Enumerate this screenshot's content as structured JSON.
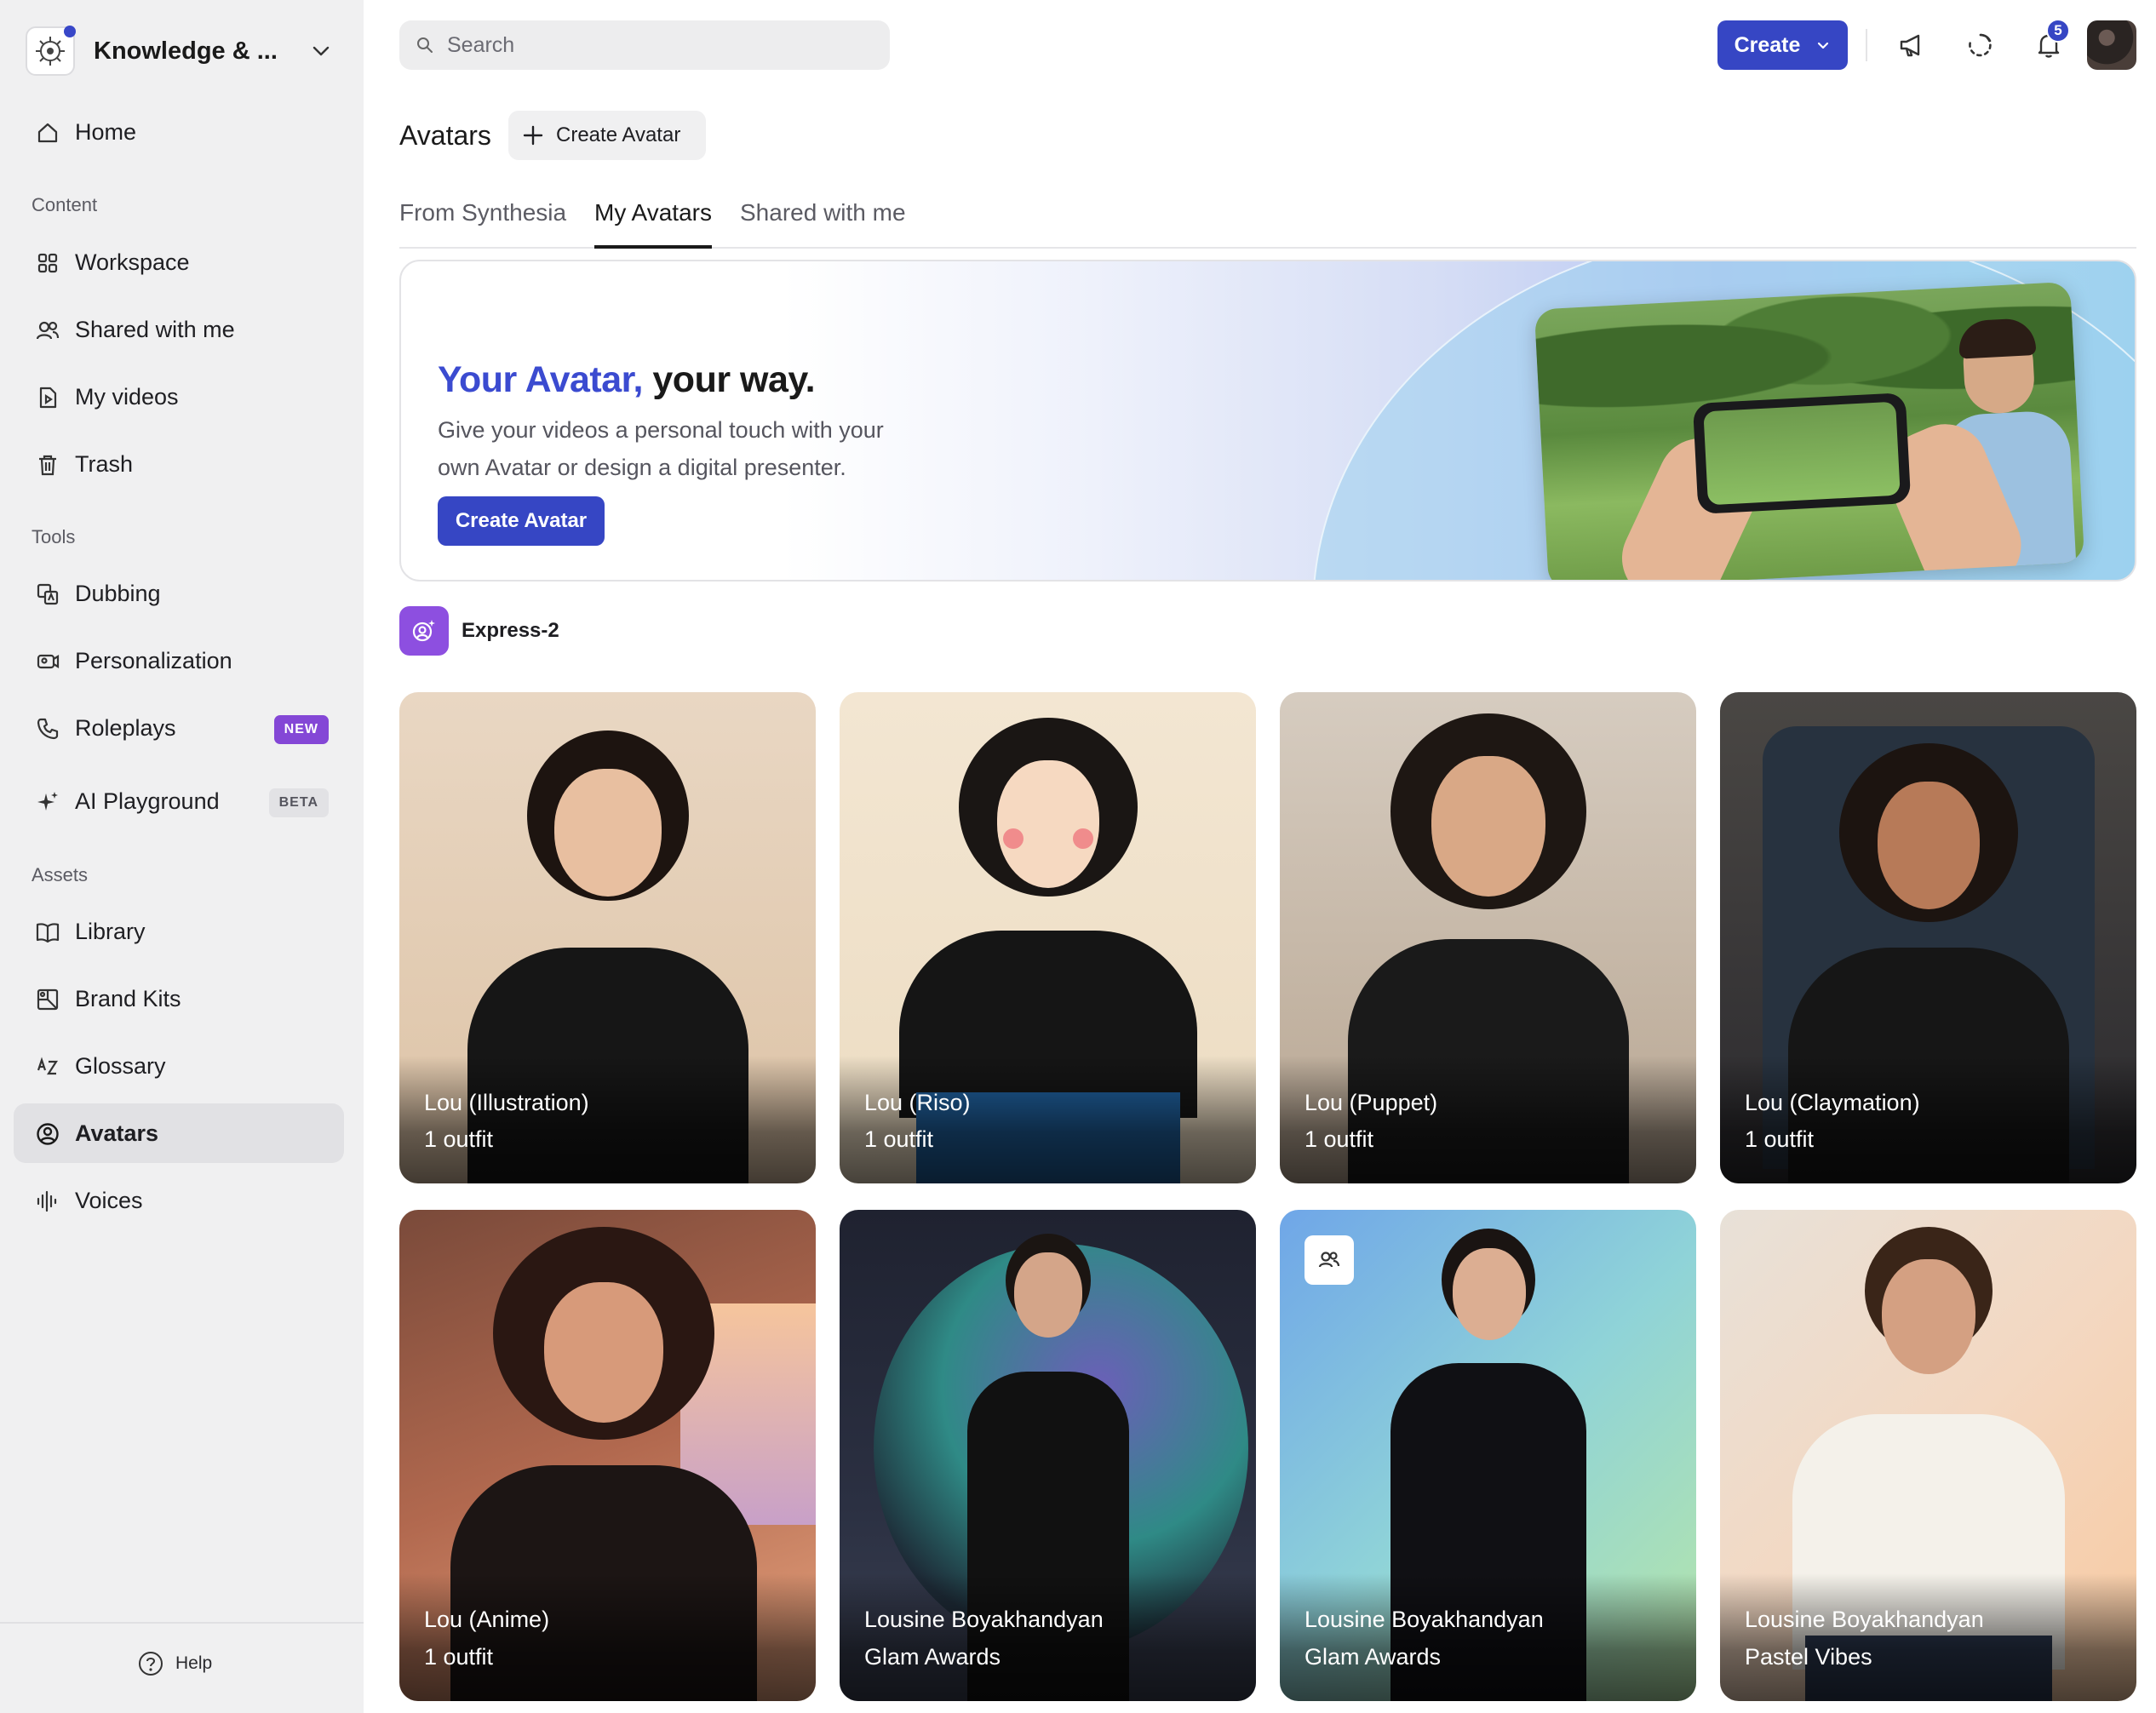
{
  "workspace": {
    "name": "Knowledge & ..."
  },
  "sidebar": {
    "home": "Home",
    "sections": {
      "content": "Content",
      "tools": "Tools",
      "assets": "Assets"
    },
    "content_items": [
      "Workspace",
      "Shared with me",
      "My videos",
      "Trash"
    ],
    "tools_items": [
      {
        "label": "Dubbing",
        "badge": ""
      },
      {
        "label": "Personalization",
        "badge": ""
      },
      {
        "label": "Roleplays",
        "badge": "NEW"
      },
      {
        "label": "AI Playground",
        "badge": "BETA"
      }
    ],
    "assets_items": [
      "Library",
      "Brand Kits",
      "Glossary",
      "Avatars",
      "Voices"
    ],
    "active": "Avatars",
    "help": "Help"
  },
  "topbar": {
    "search_placeholder": "Search",
    "create_label": "Create",
    "notifications_count": "5"
  },
  "page": {
    "title": "Avatars",
    "create_avatar_label": "Create Avatar",
    "tabs": [
      "From Synthesia",
      "My Avatars",
      "Shared with me"
    ],
    "active_tab": "My Avatars"
  },
  "banner": {
    "title_accent": "Your Avatar,",
    "title_rest": " your way.",
    "description": "Give your videos a personal touch with your own Avatar or design a digital presenter.",
    "button": "Create Avatar"
  },
  "express": {
    "label": "Express-2"
  },
  "avatars": [
    {
      "name": "Lou (Illustration)",
      "sub": "1 outfit"
    },
    {
      "name": "Lou (Riso)",
      "sub": "1 outfit"
    },
    {
      "name": "Lou (Puppet)",
      "sub": "1 outfit"
    },
    {
      "name": "Lou (Claymation)",
      "sub": "1 outfit"
    },
    {
      "name": "Lou (Anime)",
      "sub": "1 outfit"
    },
    {
      "name": "Lousine Boyakhandyan",
      "sub": "Glam Awards"
    },
    {
      "name": "Lousine Boyakhandyan",
      "sub": "Glam Awards"
    },
    {
      "name": "Lousine Boyakhandyan",
      "sub": "Pastel Vibes"
    }
  ],
  "colors": {
    "accent": "#3646c4",
    "purple": "#8447d6",
    "sidebar_bg": "#f0f0f1"
  }
}
